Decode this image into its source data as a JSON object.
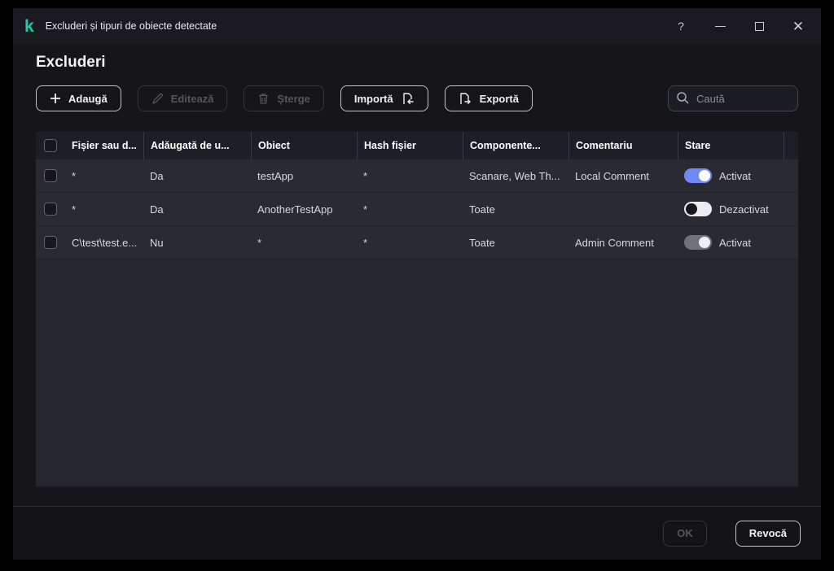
{
  "titlebar": {
    "title": "Excluderi și tipuri de obiecte detectate",
    "help_icon": "?"
  },
  "page": {
    "title": "Excluderi"
  },
  "toolbar": {
    "add_label": "Adaugă",
    "edit_label": "Editează",
    "delete_label": "Șterge",
    "import_label": "Importă",
    "export_label": "Exportă"
  },
  "search": {
    "placeholder": "Caută"
  },
  "table": {
    "columns": [
      "Fișier sau d...",
      "Adăugată de u...",
      "Obiect",
      "Hash fișier",
      "Componente...",
      "Comentariu",
      "Stare"
    ],
    "rows": [
      {
        "file": "*",
        "added_by_user": "Da",
        "object": "testApp",
        "hash": "*",
        "components": "Scanare, Web Th...",
        "comment": "Local Comment",
        "state_label": "Activat",
        "toggle_state": "on"
      },
      {
        "file": "*",
        "added_by_user": "Da",
        "object": "AnotherTestApp",
        "hash": "*",
        "components": "Toate",
        "comment": "",
        "state_label": "Dezactivat",
        "toggle_state": "off"
      },
      {
        "file": "C\\test\\test.e...",
        "added_by_user": "Nu",
        "object": "*",
        "hash": "*",
        "components": "Toate",
        "comment": "Admin Comment",
        "state_label": "Activat",
        "toggle_state": "on-disabled"
      }
    ]
  },
  "footer": {
    "ok_label": "OK",
    "cancel_label": "Revocă"
  },
  "colors": {
    "brand_teal": "#23c9a8",
    "toggle_on_blue": "#7189f3",
    "toggle_off_track": "#ececee",
    "toggle_disabled_track": "#717179",
    "window_bg": "#15151a",
    "row_bg": "#2a2a33"
  }
}
